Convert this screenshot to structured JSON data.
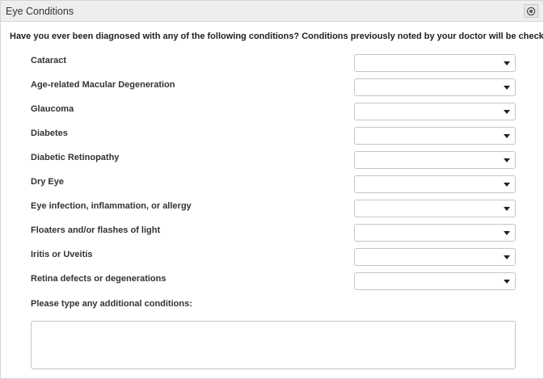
{
  "panel": {
    "title": "Eye Conditions",
    "collapse_icon": "collapse-circle-icon"
  },
  "question": "Have you ever been diagnosed with any of the following conditions? Conditions previously noted by your doctor will be checked.",
  "conditions": [
    {
      "label": "Cataract",
      "value": ""
    },
    {
      "label": "Age-related Macular Degeneration",
      "value": ""
    },
    {
      "label": "Glaucoma",
      "value": ""
    },
    {
      "label": "Diabetes",
      "value": ""
    },
    {
      "label": "Diabetic Retinopathy",
      "value": ""
    },
    {
      "label": "Dry Eye",
      "value": ""
    },
    {
      "label": "Eye infection, inflammation, or allergy",
      "value": ""
    },
    {
      "label": "Floaters and/or flashes of light",
      "value": ""
    },
    {
      "label": "Iritis or Uveitis",
      "value": ""
    },
    {
      "label": "Retina defects or degenerations",
      "value": ""
    }
  ],
  "additional": {
    "label": "Please type any additional conditions:",
    "value": ""
  }
}
